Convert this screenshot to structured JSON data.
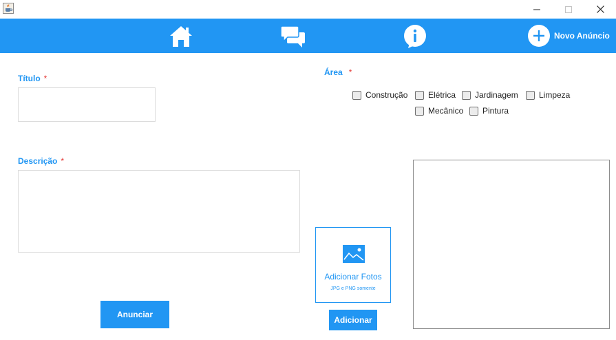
{
  "window": {
    "app_icon": "java-coffee-cup-icon",
    "controls": [
      "minimize-icon",
      "maximize-icon",
      "close-icon"
    ]
  },
  "navbar": {
    "background": "#2196f3",
    "icons": [
      "home-icon",
      "chat-icon",
      "info-icon",
      "plus-circle-icon"
    ],
    "new_ad_label": "Novo Anúncio"
  },
  "form": {
    "title": {
      "label": "Título",
      "required_mark": "*",
      "value": ""
    },
    "description": {
      "label": "Descrição",
      "required_mark": "*",
      "value": ""
    },
    "area": {
      "label": "Área",
      "required_mark": "*",
      "options": [
        {
          "label": "Construção",
          "checked": false
        },
        {
          "label": "Elétrica",
          "checked": false
        },
        {
          "label": "Jardinagem",
          "checked": false
        },
        {
          "label": "Limpeza",
          "checked": false
        },
        {
          "label": "Mecânico",
          "checked": false
        },
        {
          "label": "Pintura",
          "checked": false
        }
      ]
    }
  },
  "photos": {
    "icon": "image-icon",
    "title": "Adicionar Fotos",
    "subtitle": "JPG e PNG somente",
    "add_button": "Adicionar"
  },
  "actions": {
    "submit_label": "Anunciar"
  },
  "colors": {
    "accent": "#2196f3",
    "required": "#e53935"
  }
}
